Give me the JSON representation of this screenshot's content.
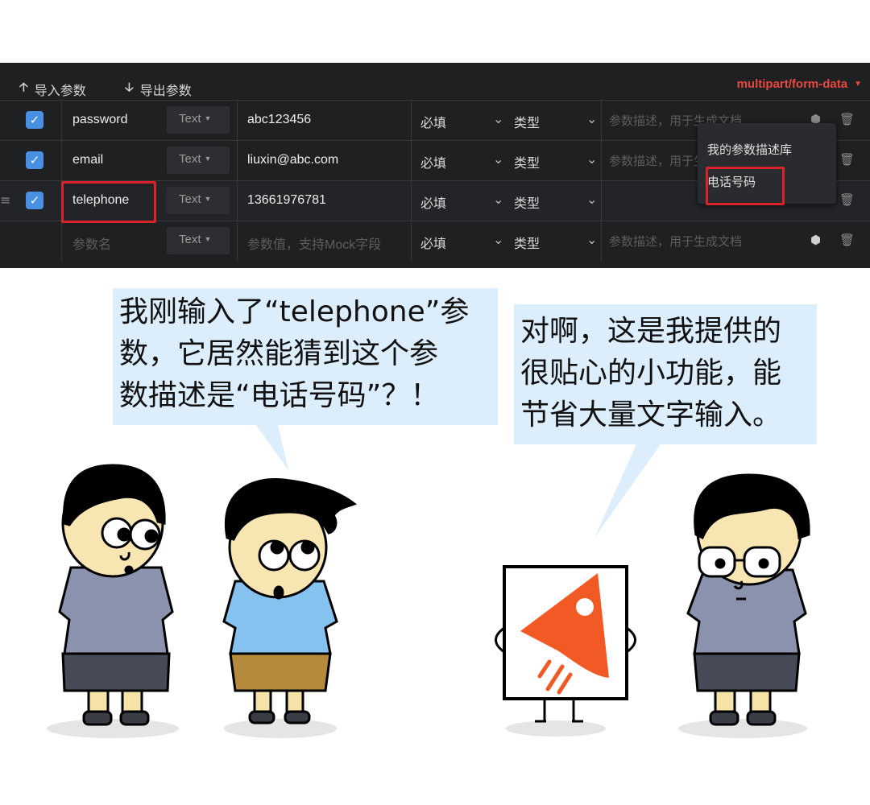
{
  "toolbar": {
    "import_label": "导入参数",
    "export_label": "导出参数",
    "content_type": "multipart/form-data"
  },
  "rows": [
    {
      "name": "password",
      "type": "Text",
      "value": "abc123456",
      "required": "必填",
      "kind": "类型",
      "description_placeholder": "参数描述，用于生成文档",
      "checked": true
    },
    {
      "name": "email",
      "type": "Text",
      "value": "liuxin@abc.com",
      "required": "必填",
      "kind": "类型",
      "description_placeholder": "参数描述，用于生成文档",
      "checked": true
    },
    {
      "name": "telephone",
      "type": "Text",
      "value": "13661976781",
      "required": "必填",
      "kind": "类型",
      "checked": true
    }
  ],
  "new_row": {
    "name_placeholder": "参数名",
    "type": "Text",
    "value_placeholder": "参数值，支持Mock字段",
    "required": "必填",
    "kind": "类型",
    "description_placeholder": "参数描述，用于生成文档"
  },
  "dropdown": {
    "library_label": "我的参数描述库",
    "suggestion": "电话号码"
  },
  "comic": {
    "left_bubble": [
      "我刚输入了“telephone”参",
      "数，它居然能猜到这个参",
      "数描述是“电话号码”？！"
    ],
    "right_bubble": [
      "对啊，这是我提供的",
      "很贴心的小功能，能",
      "节省大量文字输入。"
    ]
  },
  "colors": {
    "panel_bg": "#1f2022",
    "accent_red": "#e5483f",
    "highlight_box": "#d8232a",
    "checkbox_blue": "#4a90e2",
    "bubble_bg": "#dcedfc",
    "logo_orange": "#f15a24"
  },
  "icons": [
    "arrow-up-icon",
    "arrow-down-icon",
    "checkbox-checked-icon",
    "caret-down-icon",
    "chevron-down-icon",
    "cube-icon",
    "trash-icon",
    "drag-handle-icon"
  ]
}
